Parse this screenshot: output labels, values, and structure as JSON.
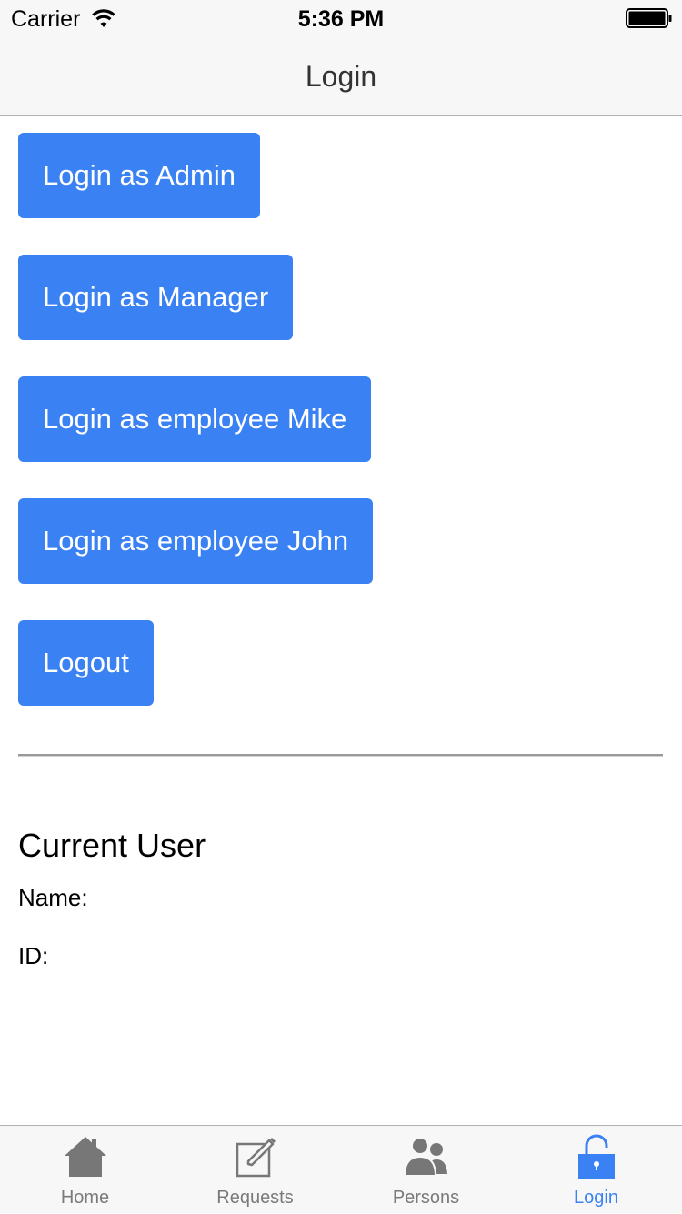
{
  "status_bar": {
    "carrier": "Carrier",
    "time": "5:36 PM",
    "wifi_icon": "wifi-icon",
    "battery_icon": "battery-icon"
  },
  "nav": {
    "title": "Login"
  },
  "buttons": {
    "admin": "Login as Admin",
    "manager": "Login as Manager",
    "mike": "Login as employee Mike",
    "john": "Login as employee John",
    "logout": "Logout"
  },
  "current_user": {
    "title": "Current User",
    "name_label": "Name:",
    "id_label": "ID:"
  },
  "tabs": [
    {
      "label": "Home",
      "icon": "home-icon",
      "active": false
    },
    {
      "label": "Requests",
      "icon": "compose-icon",
      "active": false
    },
    {
      "label": "Persons",
      "icon": "persons-icon",
      "active": false
    },
    {
      "label": "Login",
      "icon": "unlock-icon",
      "active": true
    }
  ],
  "colors": {
    "accent": "#3a81f3",
    "bar_background": "#f7f7f7",
    "inactive_tab": "#7a7a7a"
  }
}
